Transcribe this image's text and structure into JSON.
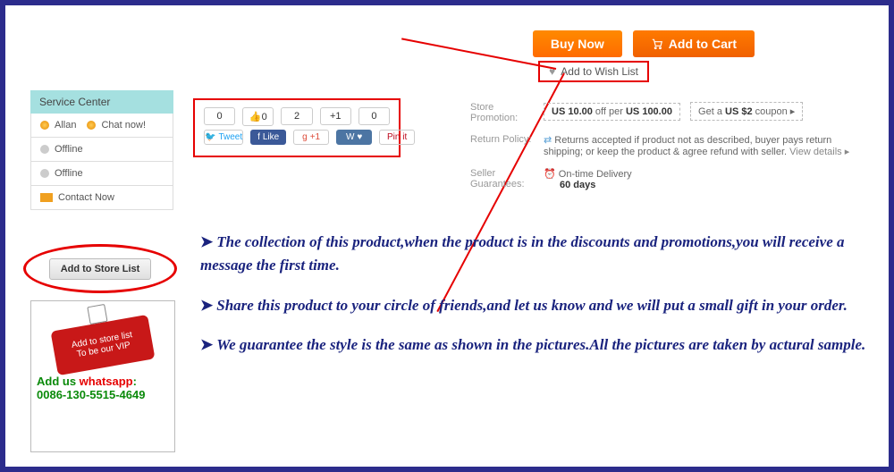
{
  "top": {
    "buy_now": "Buy Now",
    "add_to_cart": "Add to Cart",
    "wishlist": "Add to Wish List"
  },
  "sidebar": {
    "header": "Service Center",
    "allan": "Allan",
    "chat": "Chat now!",
    "offline1": "Offline",
    "offline2": "Offline",
    "contact": "Contact Now",
    "store_list": "Add to Store List"
  },
  "promo": {
    "vip_line1": "Add to store list",
    "vip_line2": "To be our VIP",
    "add_us": "Add us ",
    "whatsapp": "whatsapp",
    "colon": ":",
    "phone": "0086-130-5515-4649"
  },
  "share": {
    "counts": [
      "0",
      "0",
      "2",
      "+1",
      "0"
    ],
    "tweet": "Tweet",
    "like": "Like",
    "gplus": "+1",
    "vk": "",
    "pinit": "Pin it",
    "like_prefix": "👍"
  },
  "info": {
    "store_label": "Store Promotion:",
    "pill1_a": "US 10.00",
    "pill1_b": " off per ",
    "pill1_c": "US 100.00",
    "pill2_a": "Get a ",
    "pill2_b": "US $2",
    "pill2_c": " coupon ",
    "return_label": "Return Policy:",
    "return_text": "Returns accepted if product not as described, buyer pays return shipping; or keep the product & agree refund with seller. ",
    "view": "View details ▸",
    "guar_label": "Seller Guarantees:",
    "guar_text1": "On-time Delivery",
    "guar_text2": "60 days"
  },
  "bullets": {
    "b1": "The collection of this product,when the product is in the discounts and promotions,you will receive a message the first time.",
    "b2": "Share this product to your circle of friends,and let us know and we will put a small gift in your order.",
    "b3": "We guarantee the style is the same as shown in the pictures.All the pictures are taken by actural sample."
  }
}
